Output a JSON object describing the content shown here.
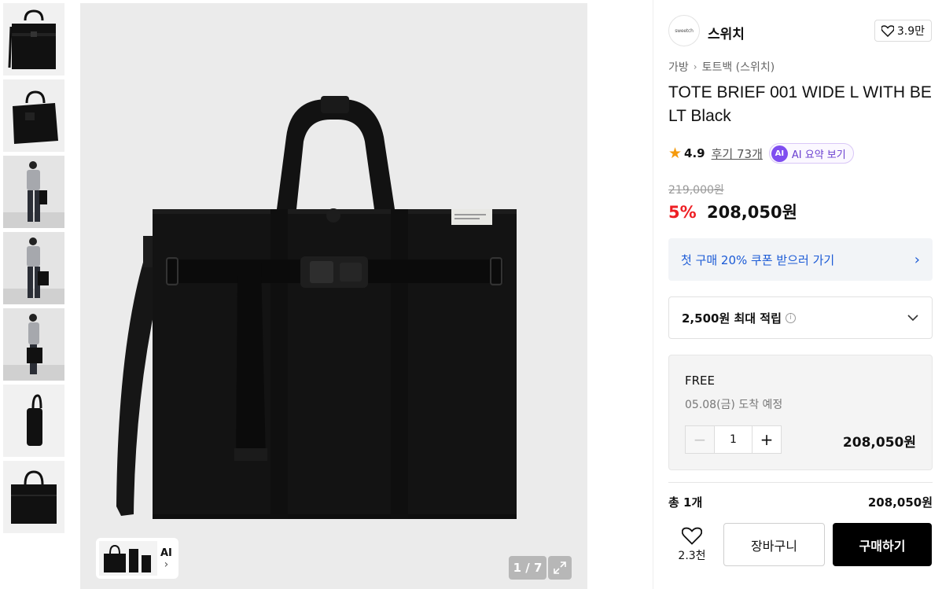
{
  "gallery": {
    "thumbnails": [
      {
        "icon": "bag-front-photo"
      },
      {
        "icon": "bag-angle-photo"
      },
      {
        "icon": "model-front-photo"
      },
      {
        "icon": "model-carry-photo"
      },
      {
        "icon": "model-side-photo"
      },
      {
        "icon": "bag-side-photo"
      },
      {
        "icon": "bag-flat-photo"
      }
    ],
    "ai_label": "AI",
    "ai_chevron": "›",
    "pager": "1 / 7"
  },
  "brand": {
    "logo_text": "sweetch",
    "name": "스위치",
    "likes": "3.9만"
  },
  "breadcrumb": {
    "category": "가방",
    "separator": "›",
    "subcategory": "토트백 (스위치)"
  },
  "product": {
    "title": "TOTE BRIEF 001 WIDE L WITH BELT Black",
    "rating": "4.9",
    "reviews": "후기 73개",
    "ai_badge": "AI",
    "ai_summary": "AI 요약 보기",
    "original_price": "219,000원",
    "discount": "5%",
    "price": "208,050원"
  },
  "coupon": {
    "text": "첫 구매 20% 쿠폰 받으러 가기",
    "chevron": "›"
  },
  "points": {
    "text": "2,500원 최대 적립",
    "info": "i"
  },
  "option": {
    "shipping": "FREE",
    "arrival": "05.08(금) 도착 예정",
    "minus": "−",
    "quantity": "1",
    "plus": "+",
    "price": "208,050원"
  },
  "total": {
    "label": "총 1개",
    "price": "208,050원"
  },
  "actions": {
    "wish_count": "2.3천",
    "cart": "장바구니",
    "buy": "구매하기"
  },
  "colors": {
    "accent_discount": "#ee1f24",
    "coupon_text": "#1b5ad6",
    "ai_purple": "#7f4ef0",
    "star": "#f59a0c",
    "buy_button": "#000000"
  }
}
